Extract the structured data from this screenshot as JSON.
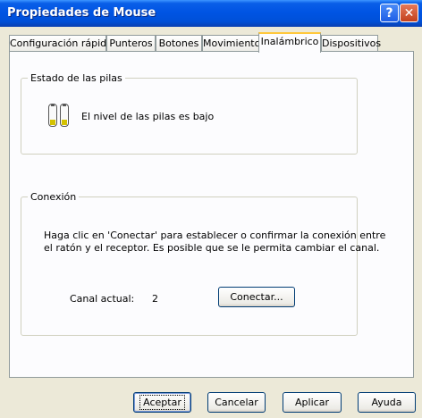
{
  "window": {
    "title": "Propiedades de Mouse",
    "help_glyph": "?",
    "close_glyph": "✕"
  },
  "tabs": [
    {
      "label": "Configuración rápida",
      "active": false
    },
    {
      "label": "Punteros",
      "active": false
    },
    {
      "label": "Botones",
      "active": false
    },
    {
      "label": "Movimiento",
      "active": false
    },
    {
      "label": "Inalámbrico",
      "active": true
    },
    {
      "label": "Dispositivos",
      "active": false
    }
  ],
  "battery": {
    "group_title": "Estado de las pilas",
    "status_text": "El nivel de las pilas es bajo",
    "icon": "battery-low-icon",
    "level": 0.25
  },
  "connection": {
    "group_title": "Conexión",
    "description_line1": "Haga clic en 'Conectar' para establecer o confirmar la conexión entre",
    "description_line2": "el ratón y el receptor. Es posible que se le permita cambiar el canal.",
    "channel_label": "Canal actual:",
    "channel_value": "2",
    "connect_button": "Conectar..."
  },
  "footer": {
    "accept": "Aceptar",
    "cancel": "Cancelar",
    "apply": "Aplicar",
    "help": "Ayuda"
  },
  "colors": {
    "titlebar": "#0054e3",
    "dialog_bg": "#ece9d8",
    "panel_bg": "#fcfcfe",
    "active_tab_accent": "#ffc83c",
    "battery_fill": "#d4c200"
  }
}
